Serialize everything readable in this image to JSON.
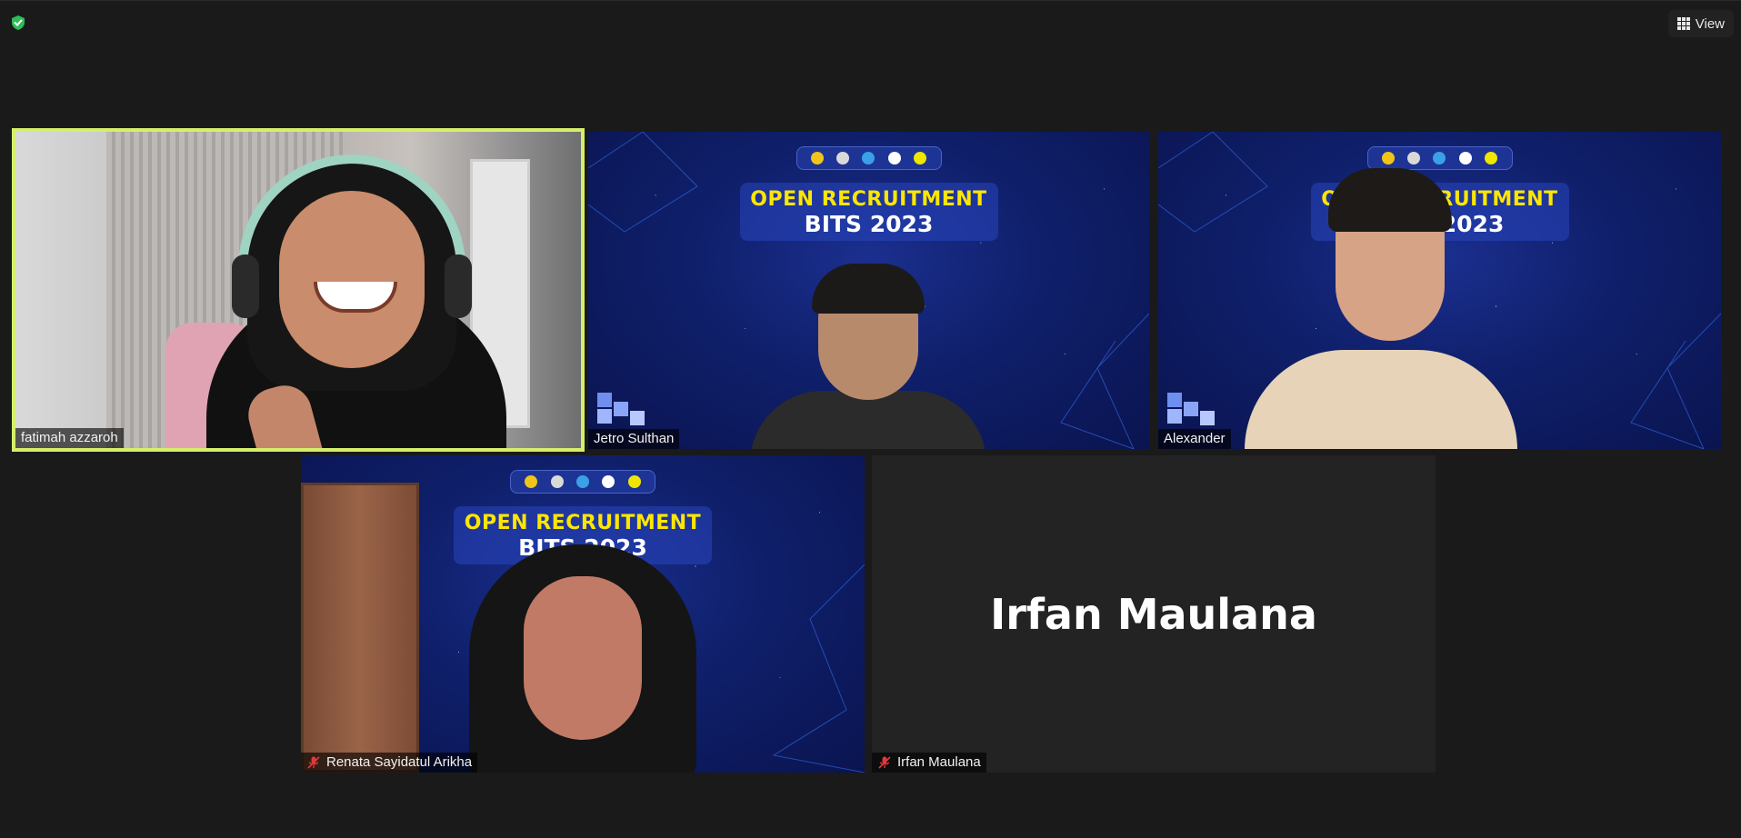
{
  "toolbar": {
    "view_label": "View"
  },
  "participants": [
    {
      "name": "fatimah azzaroh",
      "muted": false,
      "active_speaker": true
    },
    {
      "name": "Jetro Sulthan",
      "muted": false
    },
    {
      "name": "Alexander",
      "muted": false
    },
    {
      "name": "Renata Sayidatul Arikha",
      "muted": true
    },
    {
      "name": "Irfan Maulana",
      "muted": true,
      "video_off": true
    }
  ],
  "virtual_background": {
    "line1": "OPEN RECRUITMENT",
    "line2": "BITS 2023"
  },
  "colors": {
    "active_speaker_border": "#d6ef6a",
    "mute_icon": "#e0383b",
    "background": "#1a1a1a",
    "shield": "#2ebd59"
  }
}
